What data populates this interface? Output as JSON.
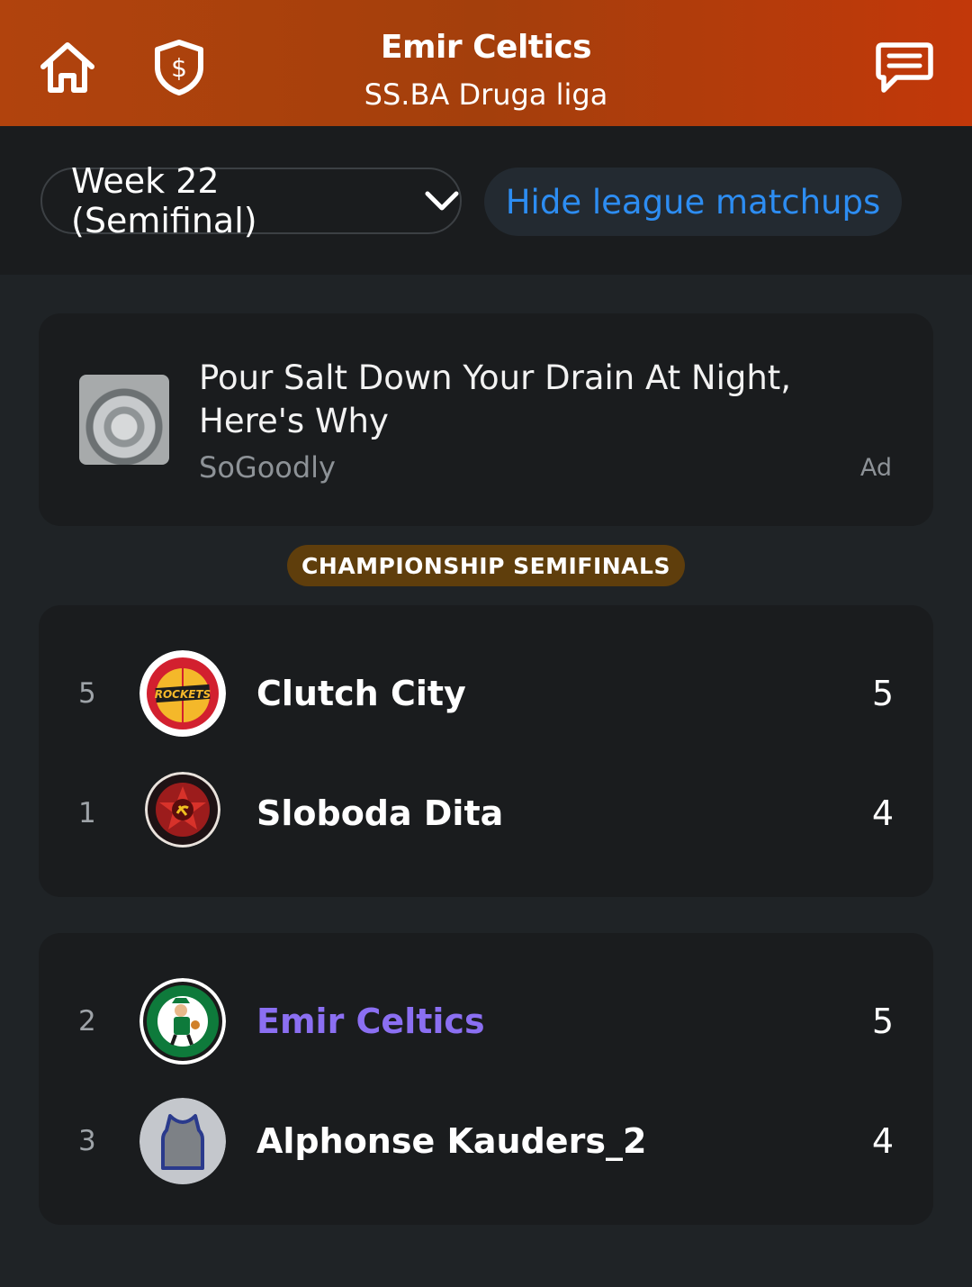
{
  "header": {
    "team_name": "Emir Celtics",
    "league_name": "SS.BA Druga  liga",
    "icons": [
      "home-icon",
      "shield-dollar-icon",
      "chat-icon"
    ]
  },
  "subbar": {
    "week_label": "Week 22 (Semifinal)",
    "hide_label": "Hide league matchups"
  },
  "ad": {
    "headline": "Pour Salt Down Your Drain At Night, Here's Why",
    "source": "SoGoodly",
    "label": "Ad"
  },
  "round_label": "CHAMPIONSHIP SEMIFINALS",
  "matchups": [
    {
      "teams": [
        {
          "seed": "5",
          "name": "Clutch City",
          "score": "5",
          "logo": "rockets-logo"
        },
        {
          "seed": "1",
          "name": "Sloboda Dita",
          "score": "4",
          "logo": "red-star-logo"
        }
      ]
    },
    {
      "teams": [
        {
          "seed": "2",
          "name": "Emir Celtics",
          "score": "5",
          "logo": "celtics-logo"
        },
        {
          "seed": "3",
          "name": "Alphonse Kauders_2",
          "score": "4",
          "logo": "jersey-logo"
        }
      ]
    }
  ],
  "colors": {
    "header_start": "#b1430d",
    "header_end": "#c2380a",
    "accent_link": "#2d8df2",
    "my_team": "#8b6ff2",
    "pill_bg": "#5f3e0c"
  }
}
